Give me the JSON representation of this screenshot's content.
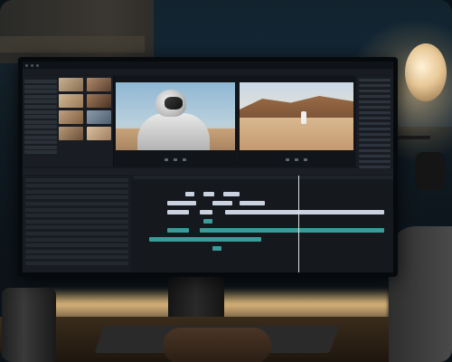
{
  "scene": {
    "description_visible_text": "",
    "monitor_app": {
      "menu": [
        "",
        "",
        "",
        "",
        ""
      ]
    }
  },
  "colors": {
    "video_clip": "#c9d2de",
    "audio_clip": "#3b9a9a",
    "lamp_glow": "#ffd696",
    "editor_bg": "#14171c"
  }
}
